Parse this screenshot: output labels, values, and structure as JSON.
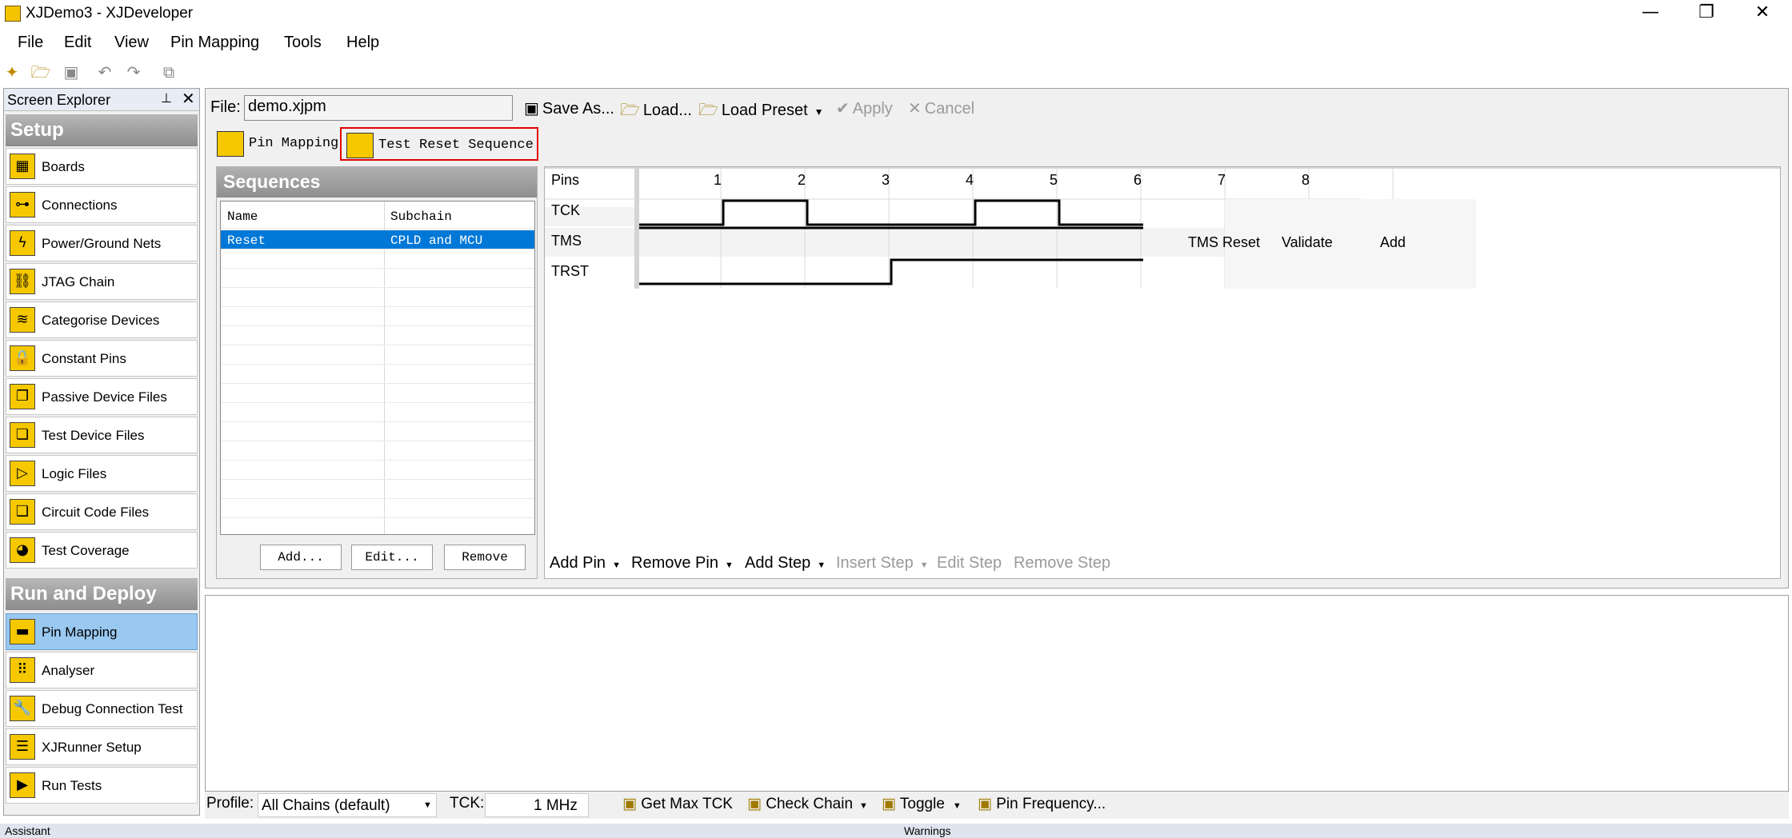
{
  "window": {
    "title": "XJDemo3 - XJDeveloper",
    "minimize": "—",
    "restore": "❐",
    "close": "✕"
  },
  "menu": [
    "File",
    "Edit",
    "View",
    "Pin Mapping",
    "Tools",
    "Help"
  ],
  "explorer": {
    "title": "Screen Explorer",
    "pin": "📌",
    "close": "✕",
    "setup_title": "Setup",
    "setup_items": [
      {
        "label": "Boards",
        "icon": "boards-icon"
      },
      {
        "label": "Connections",
        "icon": "connections-icon"
      },
      {
        "label": "Power/Ground Nets",
        "icon": "power-icon"
      },
      {
        "label": "JTAG Chain",
        "icon": "jtag-icon"
      },
      {
        "label": "Categorise Devices",
        "icon": "categorise-icon"
      },
      {
        "label": "Constant Pins",
        "icon": "lock-icon"
      },
      {
        "label": "Passive Device Files",
        "icon": "passive-icon"
      },
      {
        "label": "Test Device Files",
        "icon": "test-device-icon"
      },
      {
        "label": "Logic Files",
        "icon": "logic-icon"
      },
      {
        "label": "Circuit Code Files",
        "icon": "circuit-code-icon"
      },
      {
        "label": "Test Coverage",
        "icon": "coverage-icon"
      }
    ],
    "run_title": "Run and Deploy",
    "run_items": [
      {
        "label": "Pin Mapping",
        "icon": "pin-mapping-icon"
      },
      {
        "label": "Analyser",
        "icon": "analyser-icon"
      },
      {
        "label": "Debug Connection Test",
        "icon": "wrench-icon"
      },
      {
        "label": "XJRunner Setup",
        "icon": "list-icon"
      },
      {
        "label": "Run Tests",
        "icon": "play-icon"
      }
    ]
  },
  "file_bar": {
    "file_label": "File:",
    "file_value": "demo.xjpm",
    "save_as": "Save As...",
    "load": "Load...",
    "load_preset": "Load Preset",
    "apply": "Apply",
    "cancel": "Cancel"
  },
  "tabs": [
    "Pin Mapping",
    "Test Reset Sequence"
  ],
  "sequences": {
    "title": "Sequences",
    "col_name": "Name",
    "col_subchain": "Subchain",
    "rows": [
      {
        "name": "Reset",
        "subchain": "CPLD and MCU"
      }
    ],
    "add": "Add...",
    "edit": "Edit...",
    "remove": "Remove"
  },
  "wave": {
    "pins_header": "Pins",
    "steps": [
      "1",
      "2",
      "3",
      "4",
      "5",
      "6",
      "7",
      "8"
    ],
    "pins": [
      "TCK",
      "TMS",
      "TRST"
    ],
    "tms_actions": [
      "TMS Reset",
      "Validate",
      "Add"
    ],
    "tck_levels": [
      0,
      1,
      0,
      0,
      1,
      0
    ],
    "tms_levels": [
      1,
      1,
      1,
      1,
      1,
      1
    ],
    "trst_levels": [
      0,
      0,
      0,
      1,
      1,
      1
    ],
    "add_pin": "Add Pin",
    "remove_pin": "Remove Pin",
    "add_step": "Add Step",
    "insert_step": "Insert Step",
    "edit_step": "Edit Step",
    "remove_step": "Remove Step"
  },
  "status": {
    "profile_label": "Profile:",
    "profile_value": "All Chains (default)",
    "tck_label": "TCK:",
    "tck_value": "1 MHz",
    "get_max_tck": "Get Max TCK",
    "check_chain": "Check Chain",
    "toggle": "Toggle",
    "pin_frequency": "Pin Frequency..."
  },
  "footer": {
    "assistant": "Assistant",
    "warnings": "Warnings"
  }
}
